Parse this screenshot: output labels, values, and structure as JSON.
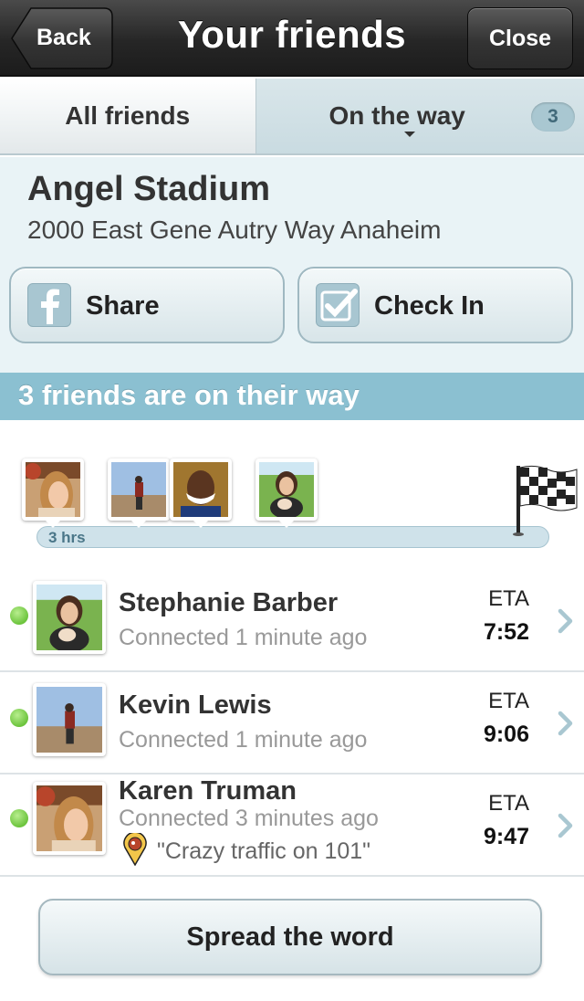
{
  "navbar": {
    "title": "Your friends",
    "back_label": "Back",
    "close_label": "Close"
  },
  "tabs": {
    "all_label": "All friends",
    "way_label": "On the way",
    "way_count": "3",
    "active": "On the way"
  },
  "venue": {
    "name": "Angel Stadium",
    "address": "2000 East Gene Autry Way Anaheim",
    "share_label": "Share",
    "checkin_label": "Check In"
  },
  "section": {
    "title": "3 friends are on their way"
  },
  "timeline": {
    "start_label": "3 hrs"
  },
  "friends": [
    {
      "name": "Stephanie Barber",
      "status": "Connected 1 minute ago",
      "eta_label": "ETA",
      "eta": "7:52",
      "online": true
    },
    {
      "name": "Kevin Lewis",
      "status": "Connected 1 minute ago",
      "eta_label": "ETA",
      "eta": "9:06",
      "online": true
    },
    {
      "name": "Karen Truman",
      "status": "Connected 3 minutes ago",
      "eta_label": "ETA",
      "eta": "9:47",
      "online": true,
      "message": "\"Crazy traffic on 101\""
    }
  ],
  "footer": {
    "spread_label": "Spread the word"
  },
  "colors": {
    "accent": "#8bc0d1",
    "navbar": "#262626",
    "online_dot": "#6cc43d",
    "chevron": "#a9c7d1"
  }
}
